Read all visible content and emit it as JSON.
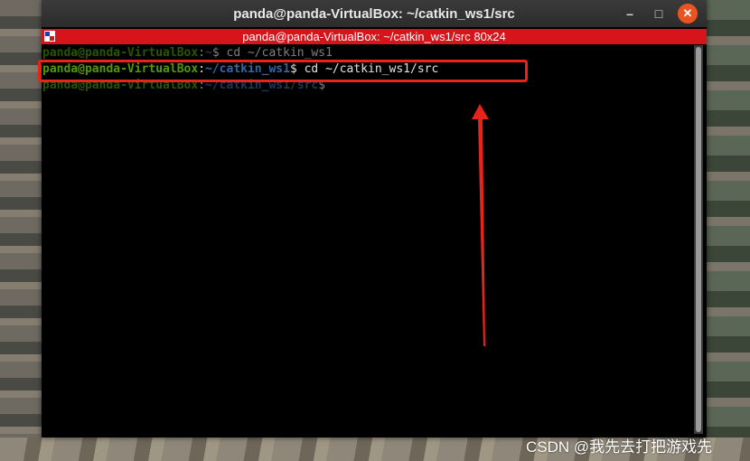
{
  "window": {
    "title": "panda@panda-VirtualBox: ~/catkin_ws1/src",
    "controls": {
      "minimize": "–",
      "maximize": "□",
      "close": "✕"
    }
  },
  "terminal_header": {
    "title": "panda@panda-VirtualBox: ~/catkin_ws1/src 80x24"
  },
  "terminal": {
    "lines": [
      {
        "user": "panda@panda-VirtualBox",
        "sep": ":",
        "path": "~",
        "prompt": "$",
        "cmd": " cd ~/catkin_ws1"
      },
      {
        "user": "panda@panda-VirtualBox",
        "sep": ":",
        "path": "~/catkin_ws1",
        "prompt": "$",
        "cmd": " cd ~/catkin_ws1/src"
      },
      {
        "user": "panda@panda-VirtualBox",
        "sep": ":",
        "path": "~/catkin_ws1/src",
        "prompt": "$",
        "cmd": ""
      }
    ]
  },
  "watermark": "CSDN @我先去打把游戏先",
  "colors": {
    "user": "#4e9a06",
    "path": "#3465a4",
    "header_bar": "#d7141a",
    "annotation": "#e8231a",
    "close_button": "#e95420"
  }
}
